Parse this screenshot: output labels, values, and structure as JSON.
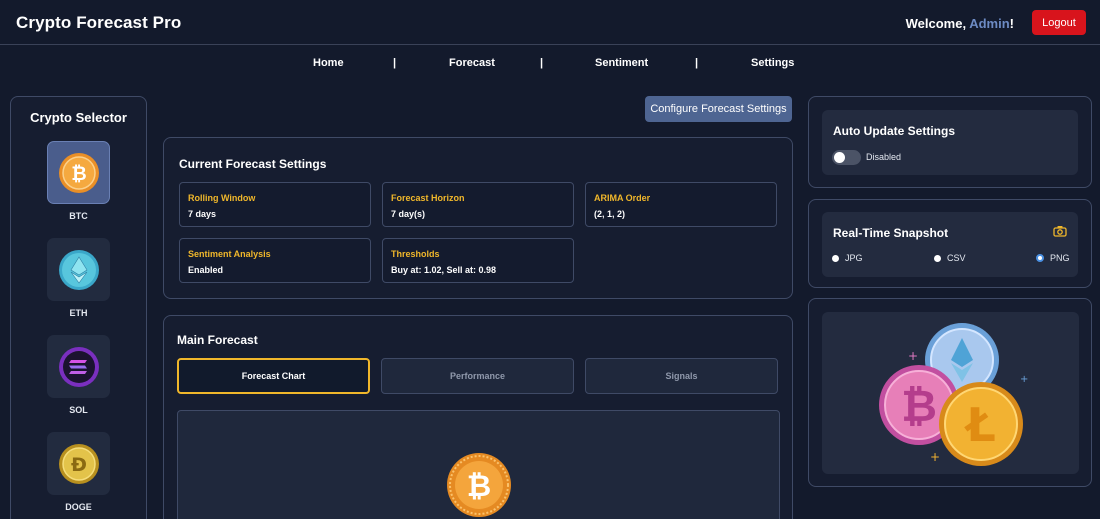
{
  "app": {
    "title": "Crypto Forecast Pro",
    "welcome_prefix": "Welcome, ",
    "username": "Admin",
    "welcome_suffix": "!",
    "logout_label": "Logout"
  },
  "nav": {
    "items": [
      "Home",
      "Forecast",
      "Sentiment",
      "Settings"
    ],
    "separator": "|"
  },
  "selector": {
    "title": "Crypto Selector",
    "coins": [
      {
        "symbol": "BTC",
        "icon": "bitcoin-icon",
        "color": "#f2a33a",
        "active": true
      },
      {
        "symbol": "ETH",
        "icon": "ethereum-icon",
        "color": "#4fc3d9",
        "active": false
      },
      {
        "symbol": "SOL",
        "icon": "solana-icon",
        "color": "#9c3fd9",
        "active": false
      },
      {
        "symbol": "DOGE",
        "icon": "dogecoin-icon",
        "color": "#d9b43a",
        "active": false
      }
    ]
  },
  "configure_button": "Configure Forecast Settings",
  "current_settings": {
    "title": "Current Forecast Settings",
    "cards": [
      {
        "label": "Rolling Window",
        "value": "7 days"
      },
      {
        "label": "Forecast Horizon",
        "value": "7 day(s)"
      },
      {
        "label": "ARIMA Order",
        "value": "(2, 1, 2)"
      },
      {
        "label": "Sentiment Analysis",
        "value": "Enabled"
      },
      {
        "label": "Thresholds",
        "value": "Buy at: 1.02, Sell at: 0.98"
      }
    ]
  },
  "main_forecast": {
    "title": "Main Forecast",
    "tabs": [
      "Forecast Chart",
      "Performance",
      "Signals"
    ],
    "active_tab": "Forecast Chart"
  },
  "auto_update": {
    "title": "Auto Update Settings",
    "toggle_state": "Disabled",
    "enabled": false
  },
  "snapshot": {
    "title": "Real-Time Snapshot",
    "icon": "camera-icon",
    "formats": [
      "JPG",
      "CSV",
      "PNG"
    ],
    "selected": "PNG"
  },
  "colors": {
    "accent": "#f0b72b",
    "brand_blue": "#4e6592",
    "logout_red": "#d8141c",
    "background": "#131a2c"
  }
}
